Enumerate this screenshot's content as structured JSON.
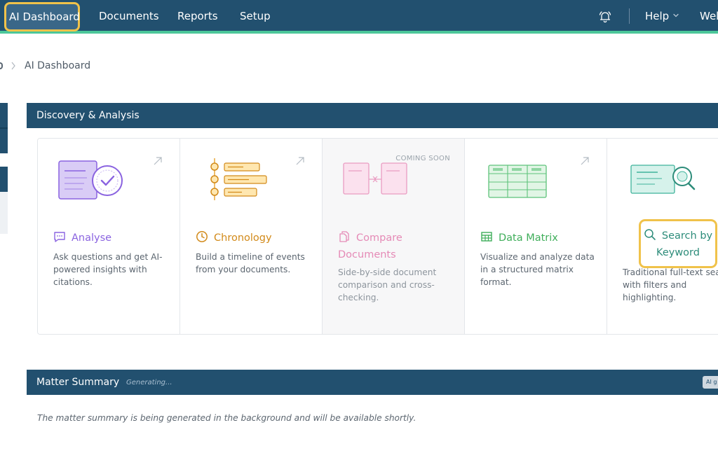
{
  "nav": {
    "items": [
      "AI Dashboard",
      "Documents",
      "Reports",
      "Setup"
    ],
    "help_label": "Help",
    "welcome_label": "Wel"
  },
  "breadcrumb": {
    "current": "AI Dashboard"
  },
  "discovery": {
    "title": "Discovery & Analysis",
    "cards": [
      {
        "title": "Analyse",
        "description": "Ask questions and get AI-powered insights with citations.",
        "color": "#8a63e0"
      },
      {
        "title": "Chronology",
        "description": "Build a timeline of events from your documents.",
        "color": "#d28a1a"
      },
      {
        "title": "Compare Documents",
        "badge": "COMING SOON",
        "description": "Side-by-side document comparison and cross-checking.",
        "color": "#e58ab6"
      },
      {
        "title": "Data Matrix",
        "description": "Visualize and analyze data in a structured matrix format.",
        "color": "#3fae5a"
      },
      {
        "title": "Search by Keyword",
        "description": "Traditional full-text sear with filters and highlighting.",
        "color": "#2d8c7a"
      }
    ]
  },
  "matter": {
    "title": "Matter Summary",
    "status": "Generating...",
    "chip": "AI g",
    "message": "The matter summary is being generated in the background and will be available shortly."
  },
  "colors": {
    "nav_bg": "#22506f",
    "accent": "#4cc79a",
    "highlight": "#f0c24a"
  }
}
